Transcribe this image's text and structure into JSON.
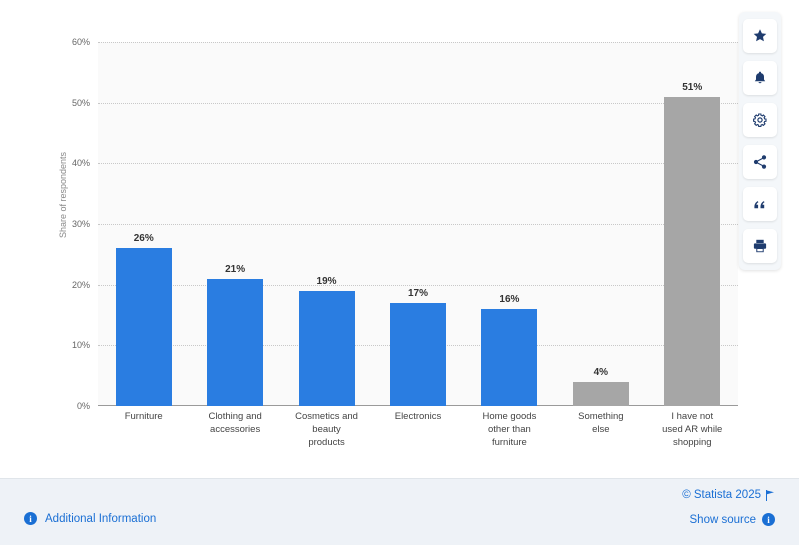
{
  "chart_data": {
    "type": "bar",
    "title": "",
    "xlabel": "",
    "ylabel": "Share of respondents",
    "ylim": [
      0,
      60
    ],
    "yticks": [
      "0%",
      "10%",
      "20%",
      "30%",
      "40%",
      "50%",
      "60%"
    ],
    "ytick_values": [
      0,
      10,
      20,
      30,
      40,
      50,
      60
    ],
    "grid": true,
    "legend": "none",
    "categories": [
      "Furniture",
      "Clothing and accessories",
      "Cosmetics and beauty products",
      "Electronics",
      "Home goods other than furniture",
      "Something else",
      "I have not used AR while shopping"
    ],
    "category_lines": [
      [
        "Furniture"
      ],
      [
        "Clothing and",
        "accessories"
      ],
      [
        "Cosmetics and",
        "beauty",
        "products"
      ],
      [
        "Electronics"
      ],
      [
        "Home goods",
        "other than",
        "furniture"
      ],
      [
        "Something",
        "else"
      ],
      [
        "I have not",
        "used AR while",
        "shopping"
      ]
    ],
    "values": [
      26,
      21,
      19,
      17,
      16,
      4,
      51
    ],
    "value_labels": [
      "26%",
      "21%",
      "19%",
      "17%",
      "16%",
      "4%",
      "51%"
    ],
    "bar_colors": [
      "#2a7de1",
      "#2a7de1",
      "#2a7de1",
      "#2a7de1",
      "#2a7de1",
      "#a6a6a6",
      "#a6a6a6"
    ]
  },
  "colors": {
    "accent_blue": "#2a7de1",
    "gray_bar": "#a6a6a6",
    "link_blue": "#1a6fd4",
    "footer_bg": "#eef2f7"
  },
  "footer": {
    "additional_information": "Additional Information",
    "copyright": "© Statista 2025",
    "show_source": "Show source"
  },
  "toolbar": {
    "items": [
      {
        "name": "star-icon",
        "label": "Favorite"
      },
      {
        "name": "bell-icon",
        "label": "Notify"
      },
      {
        "name": "gear-icon",
        "label": "Settings"
      },
      {
        "name": "share-icon",
        "label": "Share"
      },
      {
        "name": "quote-icon",
        "label": "Cite"
      },
      {
        "name": "print-icon",
        "label": "Print"
      }
    ]
  }
}
